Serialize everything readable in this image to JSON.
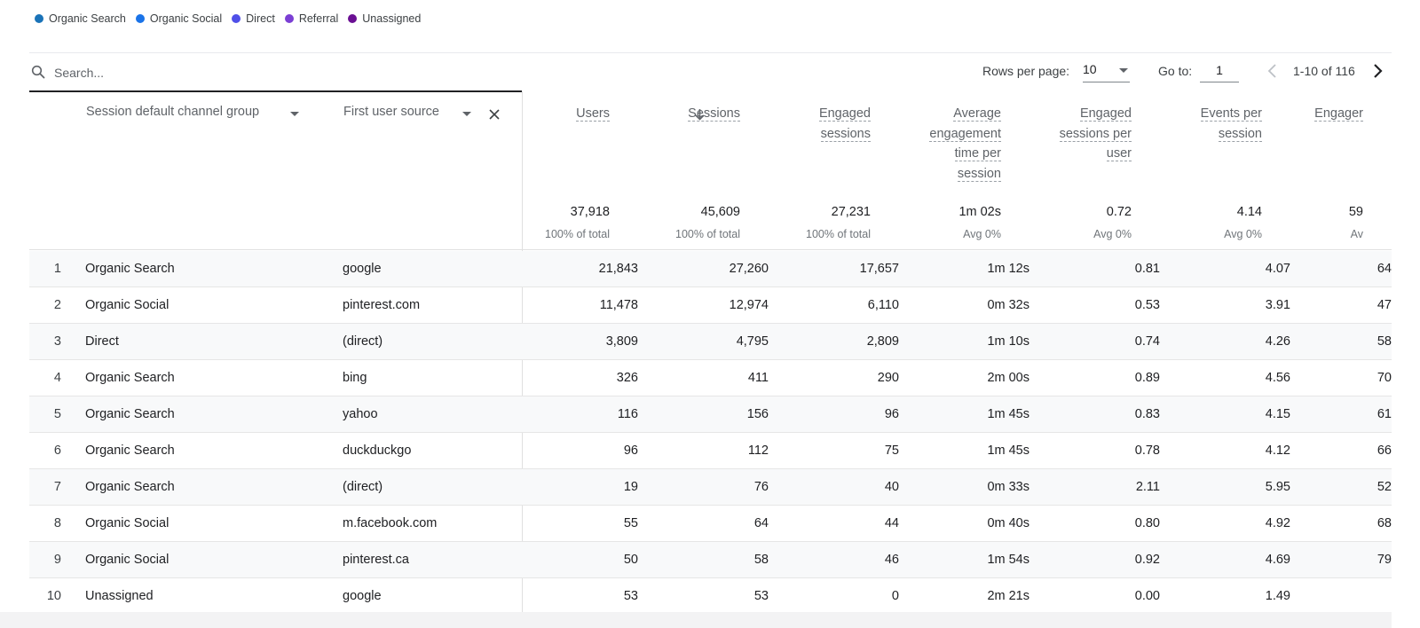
{
  "legend": [
    {
      "label": "Organic Search",
      "color": "#1a73b8"
    },
    {
      "label": "Organic Social",
      "color": "#1a73e8"
    },
    {
      "label": "Direct",
      "color": "#4f4fe8"
    },
    {
      "label": "Referral",
      "color": "#7b3fd4"
    },
    {
      "label": "Unassigned",
      "color": "#6a0f93"
    }
  ],
  "search": {
    "placeholder": "Search...",
    "value": "",
    "icon": "search-icon"
  },
  "pagination": {
    "rows_per_page_label": "Rows per page:",
    "rows_per_page_value": "10",
    "goto_label": "Go to:",
    "goto_value": "1",
    "range_text": "1-10 of 116",
    "prev_icon": "chevron-left-icon",
    "next_icon": "chevron-right-icon"
  },
  "dimensions": {
    "primary": "Session default channel group",
    "secondary": "First user source",
    "remove_icon": "close-icon"
  },
  "columns": [
    {
      "key": "users",
      "label_lines": [
        "Users"
      ],
      "total": "37,918",
      "sub": "100% of total",
      "sorted": false
    },
    {
      "key": "sessions",
      "label_lines": [
        "Sessions"
      ],
      "total": "45,609",
      "sub": "100% of total",
      "sorted": true,
      "sort_direction": "descending"
    },
    {
      "key": "engaged_sessions",
      "label_lines": [
        "Engaged",
        "sessions"
      ],
      "total": "27,231",
      "sub": "100% of total",
      "sorted": false
    },
    {
      "key": "avg_engagement_time",
      "label_lines": [
        "Average",
        "engagement",
        "time per",
        "session"
      ],
      "total": "1m 02s",
      "sub": "Avg 0%",
      "sorted": false
    },
    {
      "key": "engaged_sessions_per_user",
      "label_lines": [
        "Engaged",
        "sessions per",
        "user"
      ],
      "total": "0.72",
      "sub": "Avg 0%",
      "sorted": false
    },
    {
      "key": "events_per_session",
      "label_lines": [
        "Events per",
        "session"
      ],
      "total": "4.14",
      "sub": "Avg 0%",
      "sorted": false
    },
    {
      "key": "engagement_rate",
      "label_lines": [
        "Engager"
      ],
      "total": "59",
      "sub": "Av",
      "sorted": false
    }
  ],
  "rows": [
    {
      "index": "1",
      "channel": "Organic Search",
      "source": "google",
      "values": [
        "21,843",
        "27,260",
        "17,657",
        "1m 12s",
        "0.81",
        "4.07",
        "64"
      ]
    },
    {
      "index": "2",
      "channel": "Organic Social",
      "source": "pinterest.com",
      "values": [
        "11,478",
        "12,974",
        "6,110",
        "0m 32s",
        "0.53",
        "3.91",
        "47"
      ]
    },
    {
      "index": "3",
      "channel": "Direct",
      "source": "(direct)",
      "values": [
        "3,809",
        "4,795",
        "2,809",
        "1m 10s",
        "0.74",
        "4.26",
        "58"
      ]
    },
    {
      "index": "4",
      "channel": "Organic Search",
      "source": "bing",
      "values": [
        "326",
        "411",
        "290",
        "2m 00s",
        "0.89",
        "4.56",
        "70"
      ]
    },
    {
      "index": "5",
      "channel": "Organic Search",
      "source": "yahoo",
      "values": [
        "116",
        "156",
        "96",
        "1m 45s",
        "0.83",
        "4.15",
        "61"
      ]
    },
    {
      "index": "6",
      "channel": "Organic Search",
      "source": "duckduckgo",
      "values": [
        "96",
        "112",
        "75",
        "1m 45s",
        "0.78",
        "4.12",
        "66"
      ]
    },
    {
      "index": "7",
      "channel": "Organic Search",
      "source": "(direct)",
      "values": [
        "19",
        "76",
        "40",
        "0m 33s",
        "2.11",
        "5.95",
        "52"
      ]
    },
    {
      "index": "8",
      "channel": "Organic Social",
      "source": "m.facebook.com",
      "values": [
        "55",
        "64",
        "44",
        "0m 40s",
        "0.80",
        "4.92",
        "68"
      ]
    },
    {
      "index": "9",
      "channel": "Organic Social",
      "source": "pinterest.ca",
      "values": [
        "50",
        "58",
        "46",
        "1m 54s",
        "0.92",
        "4.69",
        "79"
      ]
    },
    {
      "index": "10",
      "channel": "Unassigned",
      "source": "google",
      "values": [
        "53",
        "53",
        "0",
        "2m 21s",
        "0.00",
        "1.49",
        ""
      ]
    }
  ]
}
